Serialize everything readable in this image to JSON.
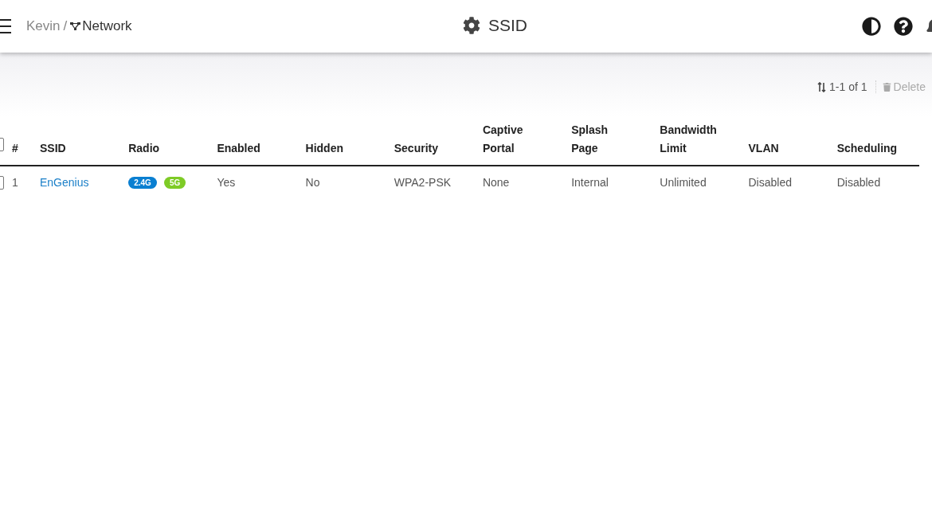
{
  "header": {
    "breadcrumb": [
      {
        "label": "Kevin",
        "kind": "link"
      },
      {
        "label": "Network",
        "kind": "current"
      }
    ],
    "separator": "/",
    "title": "SSID"
  },
  "toolbar": {
    "pagination": "1-1 of 1",
    "delete": {
      "label": "Delete",
      "disabled": true
    }
  },
  "table": {
    "select_all": {
      "checked": false
    },
    "columns": [
      "#",
      "SSID",
      "Radio",
      "Enabled",
      "Hidden",
      "Security",
      "Captive Portal",
      "Splash Page",
      "Bandwidth Limit",
      "VLAN",
      "Scheduling"
    ],
    "rows": [
      {
        "checked": false,
        "index": "1",
        "ssid": "EnGenius",
        "radio": [
          {
            "label": "2.4G",
            "color": "#0a7fd1"
          },
          {
            "label": "5G",
            "color": "#7ecb26"
          }
        ],
        "enabled": "Yes",
        "hidden": "No",
        "security": "WPA2-PSK",
        "captive_portal": "None",
        "splash_page": "Internal",
        "bandwidth_limit": "Unlimited",
        "vlan": "Disabled",
        "scheduling": "Disabled"
      }
    ]
  }
}
